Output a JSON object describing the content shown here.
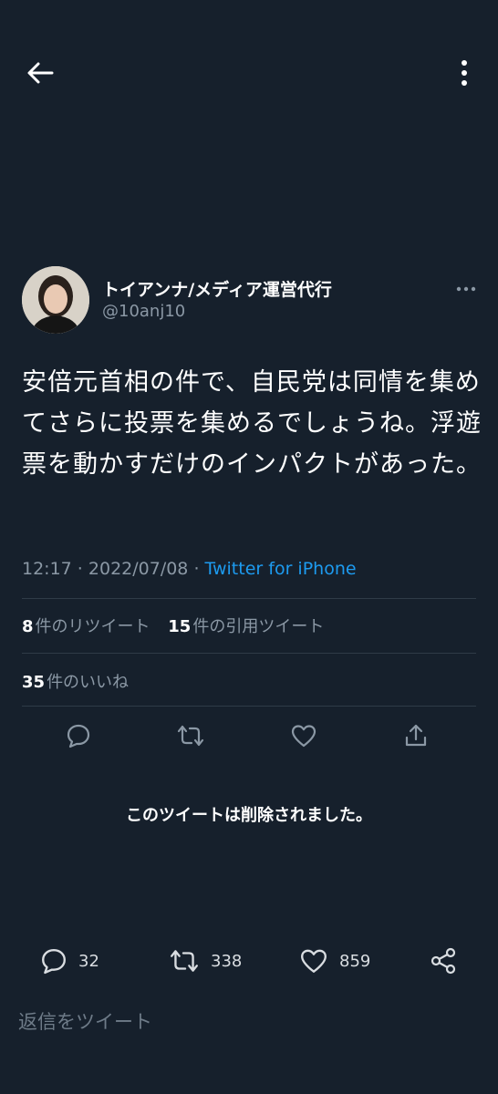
{
  "header": {
    "back_icon": "arrow-left-icon",
    "more_icon": "vertical-ellipsis-icon"
  },
  "tweet": {
    "display_name": "トイアンナ/メディア運営代行",
    "handle": "@10anj10",
    "text": "安倍元首相の件で、自民党は同情を集めてさらに投票を集めるでしょうね。浮遊票を動かすだけのインパクトがあった。",
    "time": "12:17",
    "date": "2022/07/08",
    "separator": " · ",
    "source": "Twitter for iPhone",
    "retweets": {
      "count": "8",
      "label": "件のリツイート"
    },
    "quotes": {
      "count": "15",
      "label": "件の引用ツイート"
    },
    "likes": {
      "count": "35",
      "label": "件のいいね"
    }
  },
  "quoted": {
    "deleted_notice": "このツイートは削除されました。"
  },
  "bottom_actions": {
    "replies": "32",
    "retweets": "338",
    "likes": "859"
  },
  "reply": {
    "placeholder": "返信をツイート"
  },
  "colors": {
    "background": "#16202c",
    "link": "#1d9bf0",
    "muted": "#8b98a5",
    "divider": "#2f3b47"
  }
}
